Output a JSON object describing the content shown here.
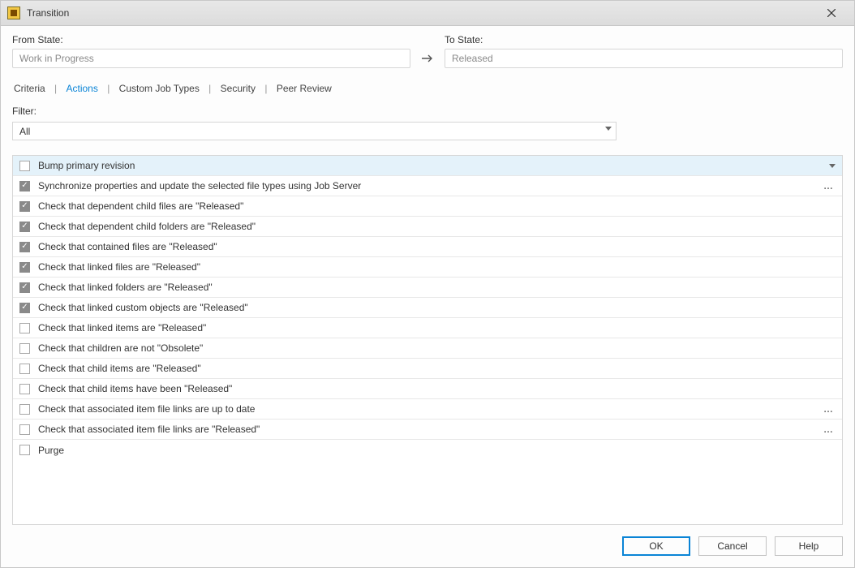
{
  "window": {
    "title": "Transition"
  },
  "from_state": {
    "label": "From State:",
    "value": "Work in Progress"
  },
  "to_state": {
    "label": "To State:",
    "value": "Released"
  },
  "tabs": {
    "criteria": "Criteria",
    "actions": "Actions",
    "custom_job_types": "Custom Job Types",
    "security": "Security",
    "peer_review": "Peer Review"
  },
  "filter": {
    "label": "Filter:",
    "value": "All"
  },
  "actions_list": [
    {
      "checked": false,
      "label": "Bump primary revision",
      "selected": true,
      "has_caret": true
    },
    {
      "checked": true,
      "label": "Synchronize properties and update the selected file types using Job Server",
      "has_dots": true
    },
    {
      "checked": true,
      "label": "Check that dependent child files are \"Released\""
    },
    {
      "checked": true,
      "label": "Check that dependent child folders are \"Released\""
    },
    {
      "checked": true,
      "label": "Check that contained files are \"Released\""
    },
    {
      "checked": true,
      "label": "Check that linked files are \"Released\""
    },
    {
      "checked": true,
      "label": "Check that linked folders are \"Released\""
    },
    {
      "checked": true,
      "label": "Check that linked custom objects are \"Released\""
    },
    {
      "checked": false,
      "label": "Check that linked items are \"Released\""
    },
    {
      "checked": false,
      "label": "Check that children are not \"Obsolete\""
    },
    {
      "checked": false,
      "label": "Check that child items are \"Released\""
    },
    {
      "checked": false,
      "label": "Check that child items have been \"Released\""
    },
    {
      "checked": false,
      "label": "Check that associated item file links are up to date",
      "has_dots": true
    },
    {
      "checked": false,
      "label": "Check that associated item file links are \"Released\"",
      "has_dots": true
    },
    {
      "checked": false,
      "label": "Purge"
    }
  ],
  "buttons": {
    "ok": "OK",
    "cancel": "Cancel",
    "help": "Help"
  }
}
